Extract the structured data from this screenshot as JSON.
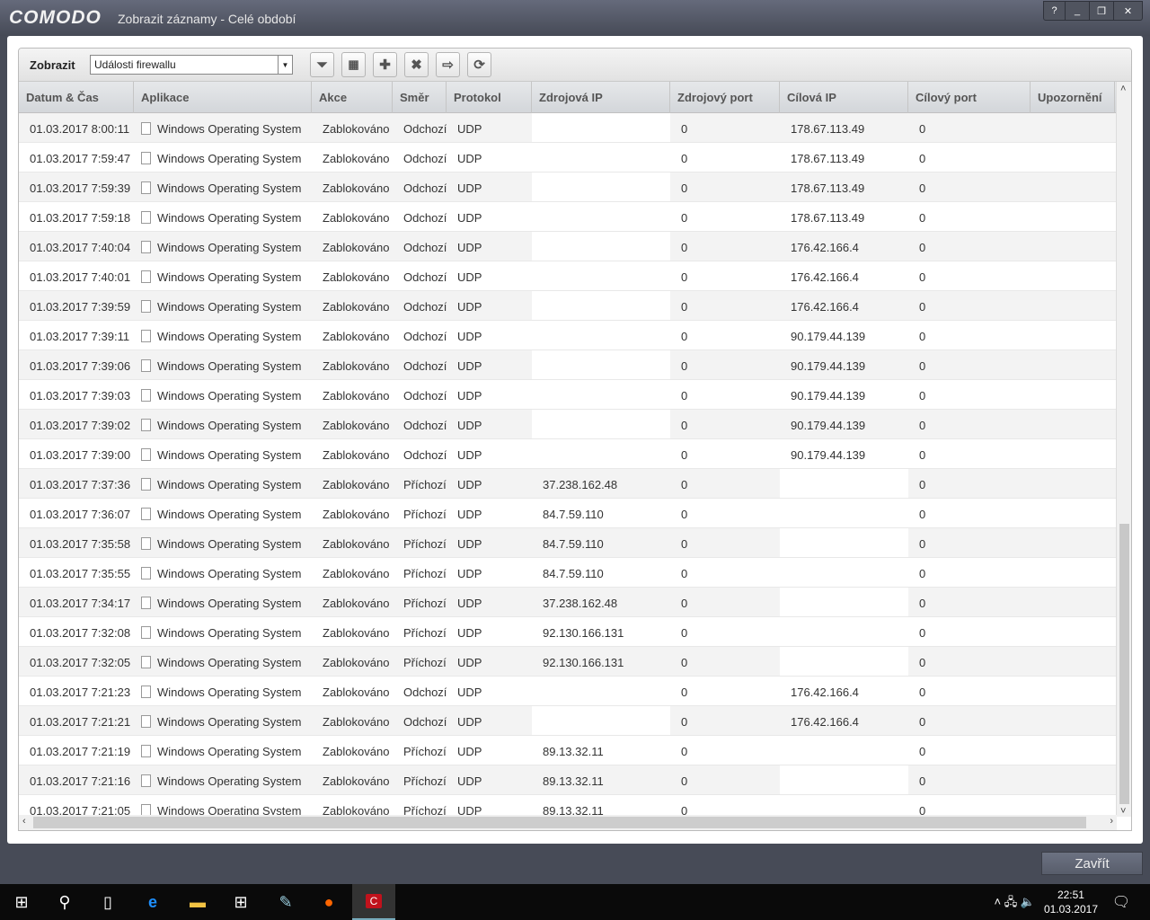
{
  "window": {
    "logo": "COMODO",
    "title": "Zobrazit záznamy - Celé období",
    "controls": [
      "?",
      "_",
      "❐",
      "✕"
    ]
  },
  "toolbar": {
    "label": "Zobrazit",
    "select_value": "Události firewallu",
    "buttons": [
      "filter-icon",
      "calendar-icon",
      "add-icon",
      "delete-icon",
      "export-icon",
      "refresh-icon"
    ]
  },
  "columns": [
    "Datum & Čas",
    "Aplikace",
    "Akce",
    "Směr",
    "Protokol",
    "Zdrojová IP",
    "Zdrojový port",
    "Cílová IP",
    "Cílový port",
    "Upozornění"
  ],
  "rows": [
    [
      "01.03.2017 8:00:11",
      "Windows Operating System",
      "Zablokováno",
      "Odchozí",
      "UDP",
      "",
      "0",
      "178.67.113.49",
      "0",
      ""
    ],
    [
      "01.03.2017 7:59:47",
      "Windows Operating System",
      "Zablokováno",
      "Odchozí",
      "UDP",
      "",
      "0",
      "178.67.113.49",
      "0",
      ""
    ],
    [
      "01.03.2017 7:59:39",
      "Windows Operating System",
      "Zablokováno",
      "Odchozí",
      "UDP",
      "",
      "0",
      "178.67.113.49",
      "0",
      ""
    ],
    [
      "01.03.2017 7:59:18",
      "Windows Operating System",
      "Zablokováno",
      "Odchozí",
      "UDP",
      "",
      "0",
      "178.67.113.49",
      "0",
      ""
    ],
    [
      "01.03.2017 7:40:04",
      "Windows Operating System",
      "Zablokováno",
      "Odchozí",
      "UDP",
      "",
      "0",
      "176.42.166.4",
      "0",
      ""
    ],
    [
      "01.03.2017 7:40:01",
      "Windows Operating System",
      "Zablokováno",
      "Odchozí",
      "UDP",
      "",
      "0",
      "176.42.166.4",
      "0",
      ""
    ],
    [
      "01.03.2017 7:39:59",
      "Windows Operating System",
      "Zablokováno",
      "Odchozí",
      "UDP",
      "",
      "0",
      "176.42.166.4",
      "0",
      ""
    ],
    [
      "01.03.2017 7:39:11",
      "Windows Operating System",
      "Zablokováno",
      "Odchozí",
      "UDP",
      "",
      "0",
      "90.179.44.139",
      "0",
      ""
    ],
    [
      "01.03.2017 7:39:06",
      "Windows Operating System",
      "Zablokováno",
      "Odchozí",
      "UDP",
      "",
      "0",
      "90.179.44.139",
      "0",
      ""
    ],
    [
      "01.03.2017 7:39:03",
      "Windows Operating System",
      "Zablokováno",
      "Odchozí",
      "UDP",
      "",
      "0",
      "90.179.44.139",
      "0",
      ""
    ],
    [
      "01.03.2017 7:39:02",
      "Windows Operating System",
      "Zablokováno",
      "Odchozí",
      "UDP",
      "",
      "0",
      "90.179.44.139",
      "0",
      ""
    ],
    [
      "01.03.2017 7:39:00",
      "Windows Operating System",
      "Zablokováno",
      "Odchozí",
      "UDP",
      "",
      "0",
      "90.179.44.139",
      "0",
      ""
    ],
    [
      "01.03.2017 7:37:36",
      "Windows Operating System",
      "Zablokováno",
      "Příchozí",
      "UDP",
      "37.238.162.48",
      "0",
      "",
      "0",
      ""
    ],
    [
      "01.03.2017 7:36:07",
      "Windows Operating System",
      "Zablokováno",
      "Příchozí",
      "UDP",
      "84.7.59.110",
      "0",
      "",
      "0",
      ""
    ],
    [
      "01.03.2017 7:35:58",
      "Windows Operating System",
      "Zablokováno",
      "Příchozí",
      "UDP",
      "84.7.59.110",
      "0",
      "",
      "0",
      ""
    ],
    [
      "01.03.2017 7:35:55",
      "Windows Operating System",
      "Zablokováno",
      "Příchozí",
      "UDP",
      "84.7.59.110",
      "0",
      "",
      "0",
      ""
    ],
    [
      "01.03.2017 7:34:17",
      "Windows Operating System",
      "Zablokováno",
      "Příchozí",
      "UDP",
      "37.238.162.48",
      "0",
      "",
      "0",
      ""
    ],
    [
      "01.03.2017 7:32:08",
      "Windows Operating System",
      "Zablokováno",
      "Příchozí",
      "UDP",
      "92.130.166.131",
      "0",
      "",
      "0",
      ""
    ],
    [
      "01.03.2017 7:32:05",
      "Windows Operating System",
      "Zablokováno",
      "Příchozí",
      "UDP",
      "92.130.166.131",
      "0",
      "",
      "0",
      ""
    ],
    [
      "01.03.2017 7:21:23",
      "Windows Operating System",
      "Zablokováno",
      "Odchozí",
      "UDP",
      "",
      "0",
      "176.42.166.4",
      "0",
      ""
    ],
    [
      "01.03.2017 7:21:21",
      "Windows Operating System",
      "Zablokováno",
      "Odchozí",
      "UDP",
      "",
      "0",
      "176.42.166.4",
      "0",
      ""
    ],
    [
      "01.03.2017 7:21:19",
      "Windows Operating System",
      "Zablokováno",
      "Příchozí",
      "UDP",
      "89.13.32.11",
      "0",
      "",
      "0",
      ""
    ],
    [
      "01.03.2017 7:21:16",
      "Windows Operating System",
      "Zablokováno",
      "Příchozí",
      "UDP",
      "89.13.32.11",
      "0",
      "",
      "0",
      ""
    ],
    [
      "01.03.2017 7:21:05",
      "Windows Operating System",
      "Zablokováno",
      "Příchozí",
      "UDP",
      "89.13.32.11",
      "0",
      "",
      "0",
      ""
    ]
  ],
  "footer": {
    "close_label": "Zavřít"
  },
  "taskbar": {
    "time": "22:51",
    "date": "01.03.2017"
  }
}
